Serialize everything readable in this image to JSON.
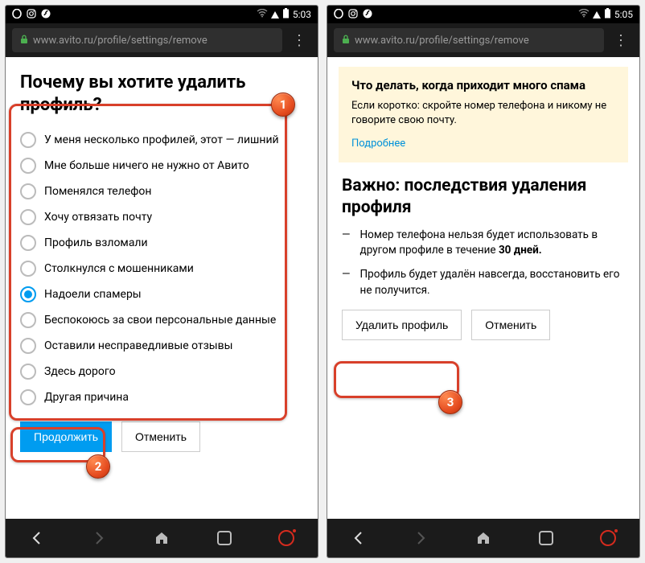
{
  "left": {
    "status_time": "5:03",
    "url": "www.avito.ru/profile/settings/remove",
    "heading": "Почему вы хотите удалить профиль?",
    "options": [
      "У меня несколько профилей, этот — лишний",
      "Мне больше ничего не нужно от Авито",
      "Поменялся телефон",
      "Хочу отвязать почту",
      "Профиль взломали",
      "Столкнулся с мошенниками",
      "Надоели спамеры",
      "Беспокоюсь за свои персональные данные",
      "Оставили несправедливые отзывы",
      "Здесь дорого",
      "Другая причина"
    ],
    "selected_index": 6,
    "continue_label": "Продолжить",
    "cancel_label": "Отменить"
  },
  "right": {
    "status_time": "5:05",
    "url": "www.avito.ru/profile/settings/remove",
    "info_title": "Что делать, когда приходит много спама",
    "info_text": "Если коротко: скройте номер телефона и никому не говорите свою почту.",
    "info_link": "Подробнее",
    "heading": "Важно: последствия удаления профиля",
    "cons1_a": "Номер телефона нельзя будет использовать в другом профиле в течение ",
    "cons1_b": "30 дней.",
    "cons2": "Профиль будет удалён навсегда, восстановить его не получится.",
    "delete_label": "Удалить профиль",
    "cancel_label": "Отменить"
  },
  "annotations": {
    "n1": "1",
    "n2": "2",
    "n3": "3"
  }
}
